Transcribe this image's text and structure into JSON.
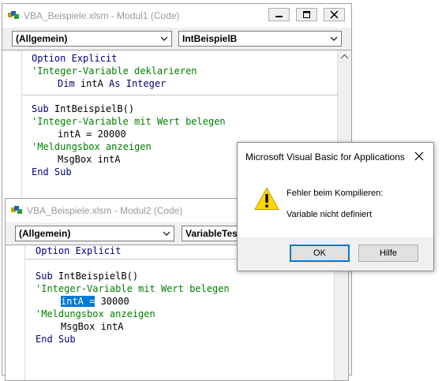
{
  "window1": {
    "title": "VBA_Beispiele.xlsm - Modul1 (Code)",
    "object_combo": "(Allgemein)",
    "procedure_combo": "IntBeispielB",
    "code": {
      "line1_kw": "Option Explicit",
      "line2_cmt": "'Integer-Variable deklarieren",
      "line3_kw_a": "Dim",
      "line3_plain": " intA ",
      "line3_kw_b": "As Integer",
      "line4_kw": "Sub",
      "line4_plain": " IntBeispielB()",
      "line5_cmt": "'Integer-Variable mit Wert belegen",
      "line6_plain": "intA = 20000",
      "line7_cmt": "'Meldungsbox anzeigen",
      "line8_plain": "MsgBox intA",
      "line9_kw": "End Sub"
    }
  },
  "window2": {
    "title": "VBA_Beispiele.xlsm - Modul2 (Code)",
    "object_combo": "(Allgemein)",
    "procedure_combo": "VariableTes",
    "code": {
      "line1_kw": "Option Explicit",
      "line2_kw": "Sub",
      "line2_plain": " IntBeispielB()",
      "line3_cmt": "'Integer-Variable mit Wert belegen",
      "line4_sel": "intA =",
      "line4_plain": " 30000",
      "line5_cmt": "'Meldungsbox anzeigen",
      "line6_plain": "MsgBox intA",
      "line7_kw": "End Sub"
    }
  },
  "dialog": {
    "title": "Microsoft Visual Basic for Applications",
    "message1": "Fehler beim Kompilieren:",
    "message2": "Variable nicht definiert",
    "ok_label": "OK",
    "help_label": "Hilfe",
    "icon": "warning-icon"
  },
  "colors": {
    "keyword": "#00007f",
    "comment": "#007f00",
    "selection": "#0078d7"
  }
}
